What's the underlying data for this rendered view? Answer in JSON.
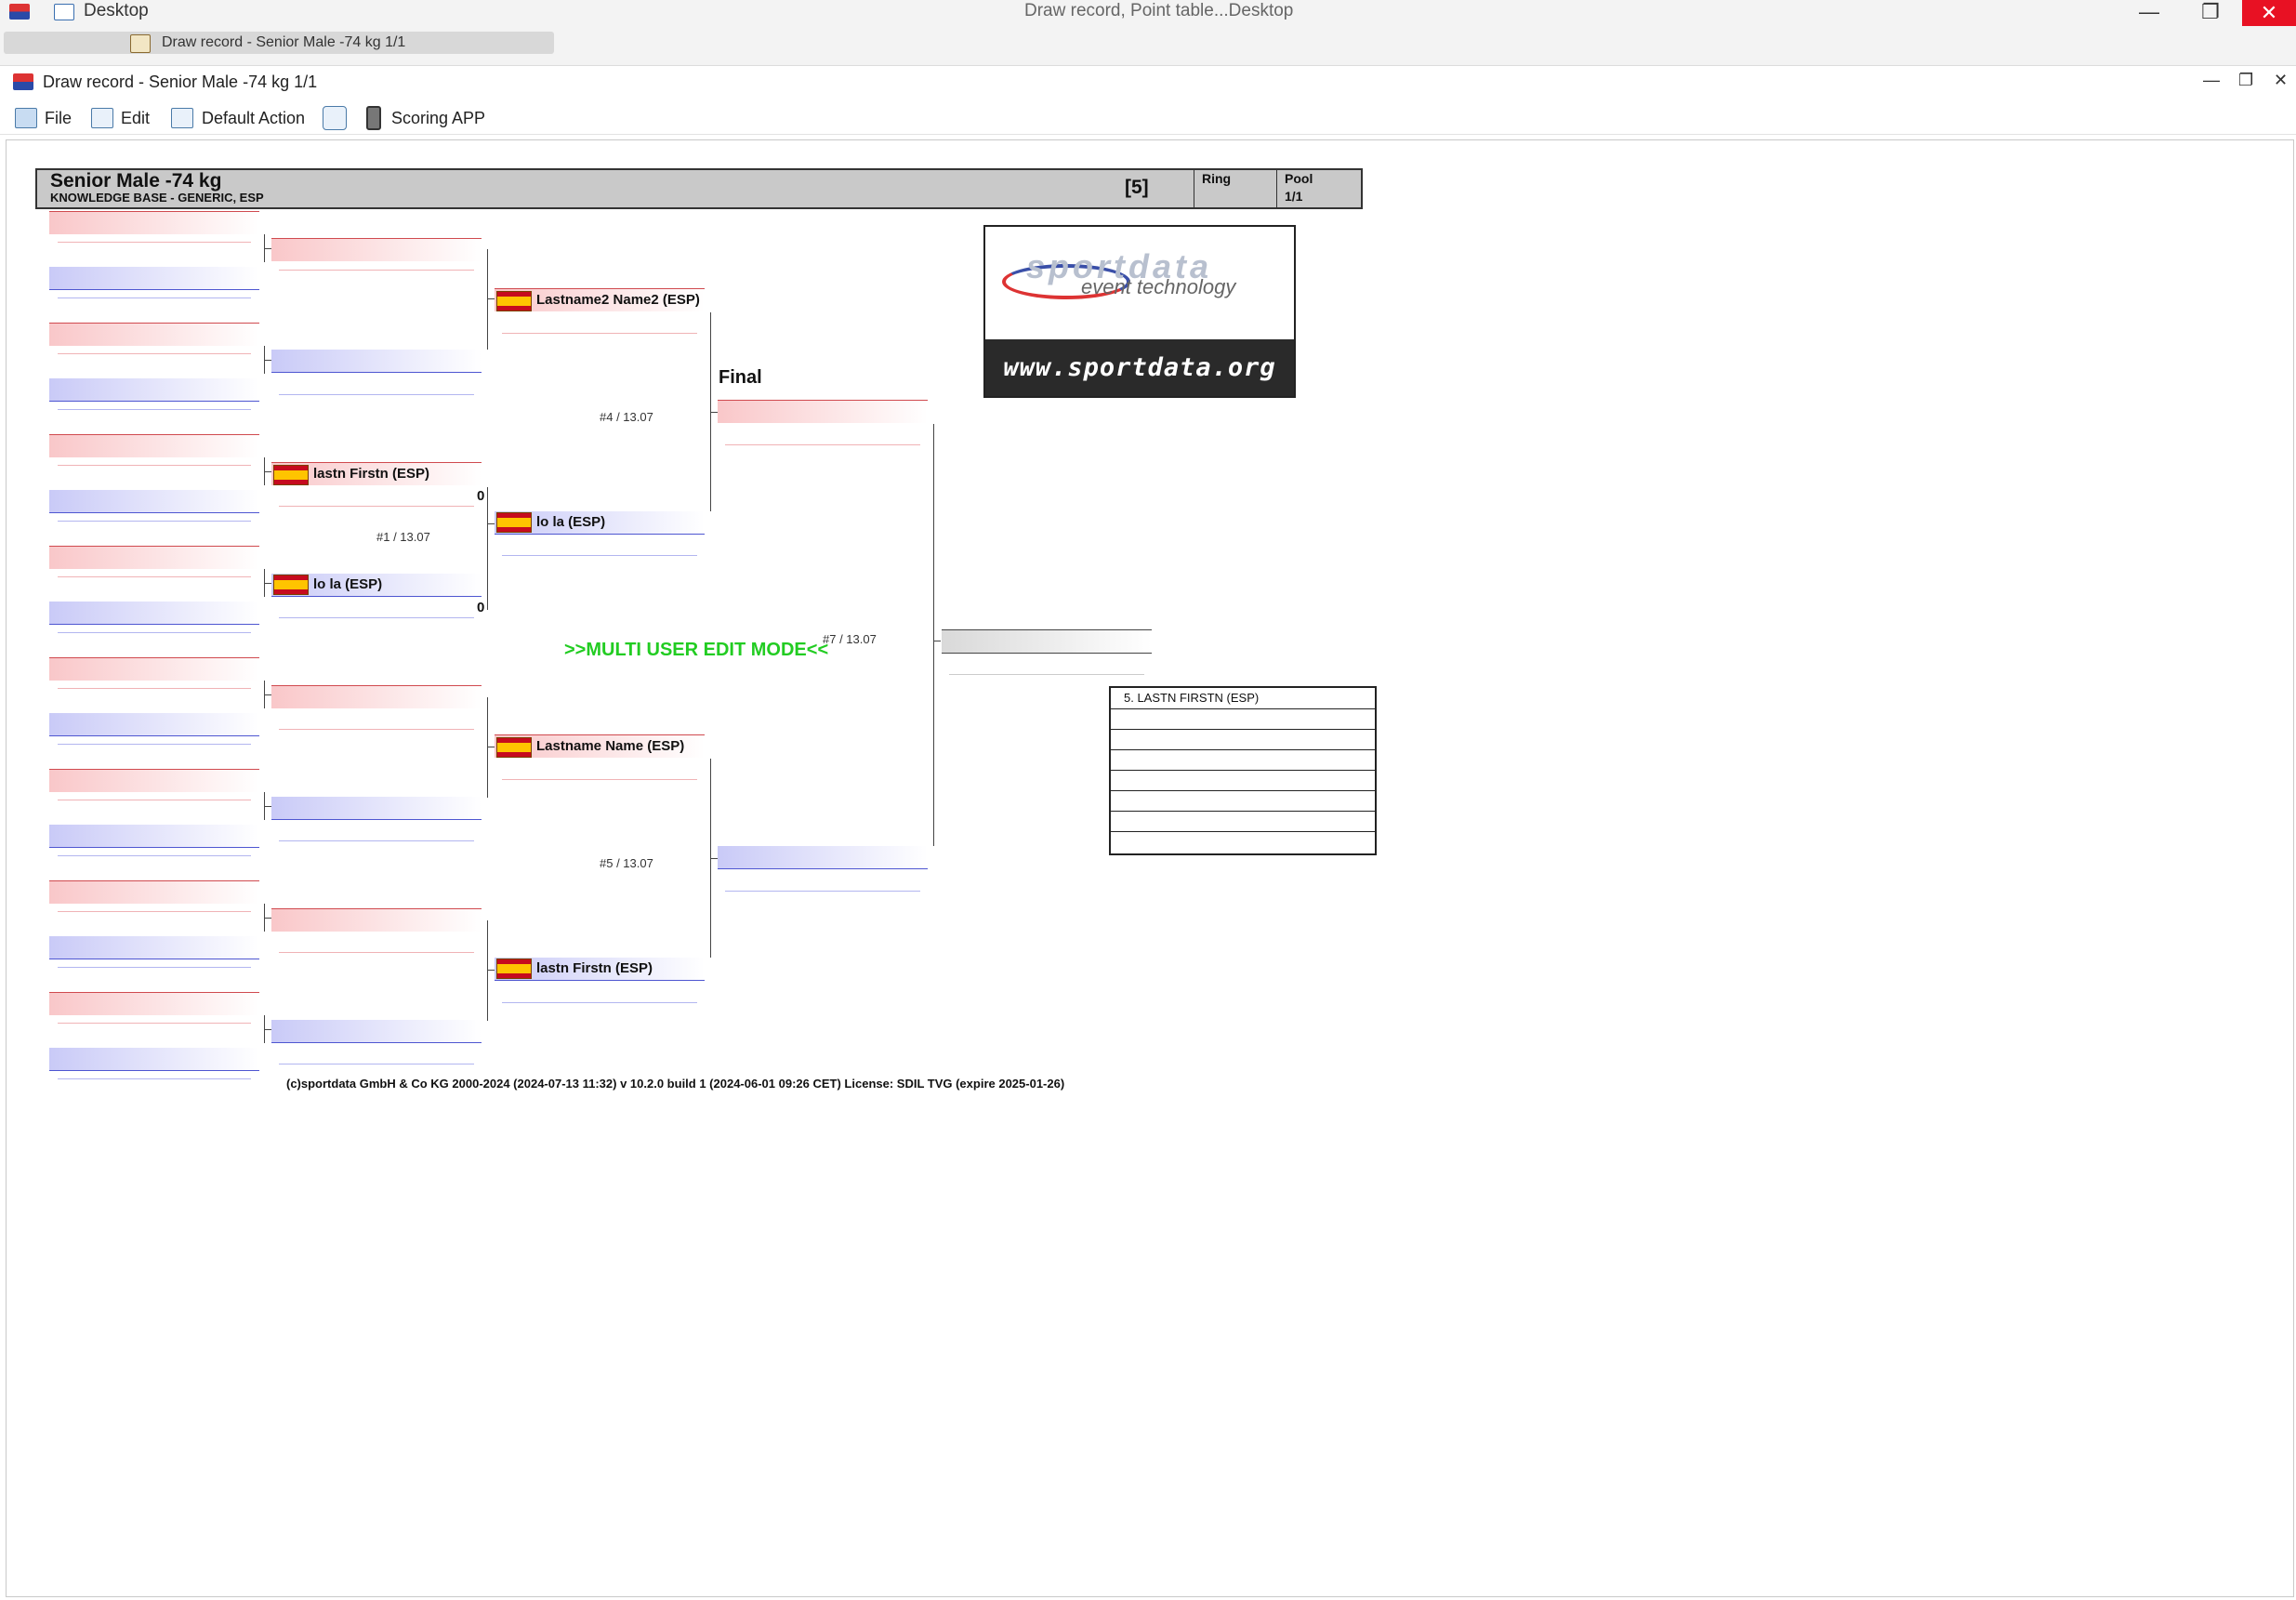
{
  "os": {
    "desktop_label": "Desktop",
    "window_title": "Draw record, Point table...Desktop",
    "task_tab": "Draw record - Senior Male -74 kg 1/1",
    "min": "—",
    "restore": "❐",
    "close": "✕"
  },
  "window": {
    "title": "Draw record - Senior Male -74 kg 1/1"
  },
  "menu": {
    "file": "File",
    "edit": "Edit",
    "default_action": "Default Action",
    "scoring_app": "Scoring APP"
  },
  "event": {
    "title": "Senior Male -74 kg",
    "subtitle": "KNOWLEDGE BASE - GENERIC, ESP",
    "count": "[5]",
    "ring_label": "Ring",
    "ring_value": "",
    "pool_label": "Pool",
    "pool_value": "1/1"
  },
  "bracket": {
    "r2": {
      "p3_red": "lastn Firstn (ESP)",
      "p4_blue": "lo la (ESP)",
      "score_red": "0",
      "score_blue": "0",
      "match": "#1 / 13.07"
    },
    "r3": {
      "p1_red": "Lastname2 Name2 (ESP)",
      "p2_blue": "lo la (ESP)",
      "p3_red": "Lastname Name (ESP)",
      "p4_blue": "lastn Firstn (ESP)",
      "match_top": "#4 / 13.07",
      "match_bottom": "#5 / 13.07"
    },
    "final": {
      "label": "Final",
      "match": "#7 / 13.07"
    },
    "multi_user": ">>MULTI USER EDIT MODE<<"
  },
  "logo": {
    "word": "sportdata",
    "tagline": "event technology",
    "url": "www.sportdata.org"
  },
  "ranking": {
    "rows": [
      "5. LASTN FIRSTN (ESP)",
      "",
      "",
      "",
      "",
      "",
      "",
      ""
    ]
  },
  "footer": "(c)sportdata GmbH & Co KG 2000-2024 (2024-07-13 11:32)  v 10.2.0 build 1 (2024-06-01 09:26 CET) License: SDIL TVG (expire 2025-01-26)"
}
